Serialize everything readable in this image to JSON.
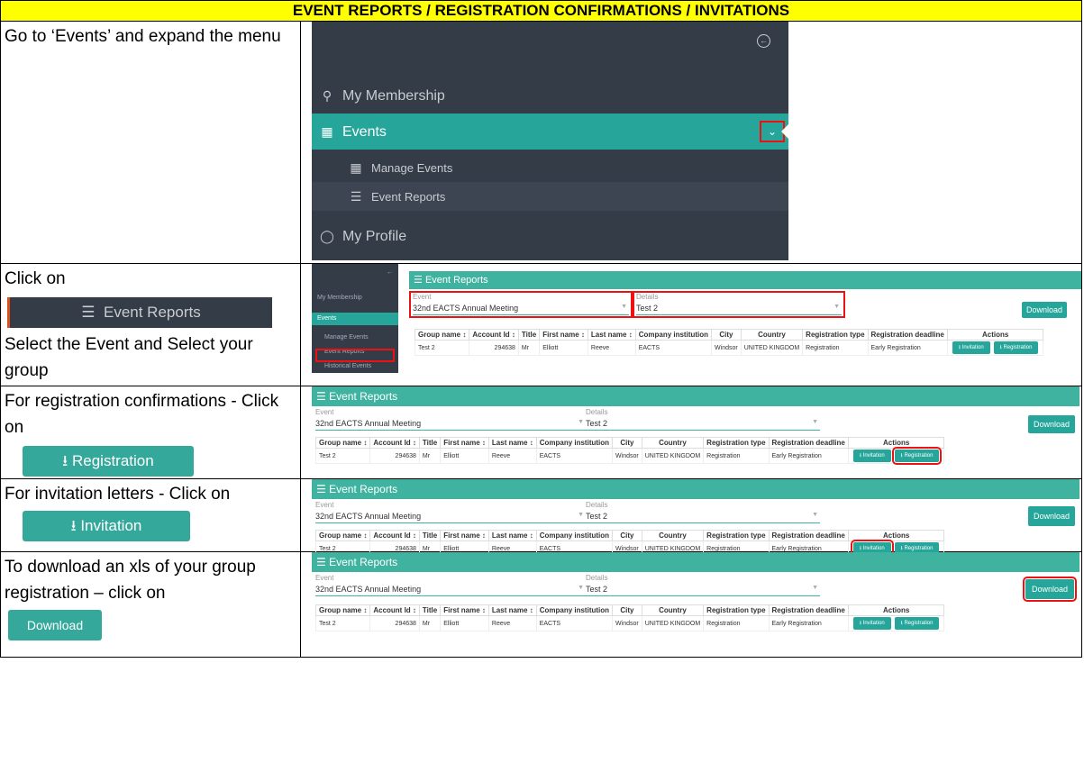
{
  "header": "EVENT REPORTS / REGISTRATION CONFIRMATIONS / INVITATIONS",
  "steps": {
    "s1": "Go to ‘Events’ and expand the menu",
    "s2a": "Click on",
    "s2b": "Select the Event and Select your group",
    "s3": "For registration confirmations - Click on",
    "s4": "For invitation letters -  Click on",
    "s5": "To download an xls of your group registration – click on"
  },
  "sidebar": {
    "membership": "My Membership",
    "events": "Events",
    "manage": "Manage Events",
    "reports": "Event Reports",
    "profile": "My Profile",
    "historical": "Historical Events"
  },
  "buttons": {
    "event_reports": "Event Reports",
    "registration": "Registration",
    "invitation": "Invitation",
    "download": "Download"
  },
  "report": {
    "title": "Event Reports",
    "event_label": "Event",
    "event_value": "32nd EACTS Annual Meeting",
    "details_label": "Details",
    "details_value": "Test 2",
    "download": "Download",
    "columns": [
      "Group name ↕",
      "Account Id ↕",
      "Title",
      "First name ↕",
      "Last name ↕",
      "Company institution",
      "City",
      "Country",
      "Registration type",
      "Registration deadline",
      "Actions"
    ],
    "row": [
      "Test 2",
      "294638",
      "Mr",
      "Elliott",
      "Reeve",
      "EACTS",
      "Windsor",
      "UNITED KINGDOM",
      "Registration",
      "Early Registration"
    ],
    "invitation": "Invitation",
    "registration": "Registration"
  },
  "colors": {
    "accent": "#26a69a",
    "sidebar": "#343c47",
    "highlight": "#ffff00",
    "marker": "#e11111"
  }
}
